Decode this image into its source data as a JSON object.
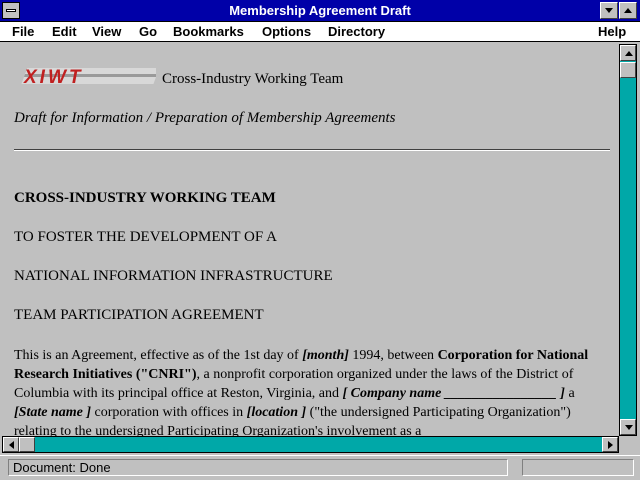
{
  "window": {
    "title": "Membership Agreement Draft"
  },
  "menu": {
    "file": "File",
    "edit": "Edit",
    "view": "View",
    "go": "Go",
    "bookmarks": "Bookmarks",
    "options": "Options",
    "directory": "Directory",
    "help": "Help"
  },
  "document": {
    "logo_text": "XIWT",
    "org_name": "Cross-Industry Working Team",
    "draft_note": "Draft for Information / Preparation of Membership Agreements",
    "heading_1": "CROSS-INDUSTRY WORKING TEAM",
    "heading_2": "TO FOSTER THE DEVELOPMENT OF A",
    "heading_3": "NATIONAL INFORMATION INFRASTRUCTURE",
    "heading_4": "TEAM PARTICIPATION AGREEMENT",
    "paragraph": {
      "p1": "This is an Agreement, effective as of the 1st day of ",
      "month": "[month]",
      "p2": " 1994, between ",
      "cnri": "Corporation for National Research Initiatives (\"CNRI\")",
      "p3": ", a nonprofit corporation organized under the laws of the District of Columbia with its principal office at Reston, Virginia, and ",
      "company": "[ Company name ________________ ]",
      "p4": " a ",
      "state": "[State name ]",
      "p5": " corporation with offices in ",
      "location": "[location ]",
      "p6": " (\"the undersigned Participating Organization\") relating to the undersigned Participating Organization's involvement as a"
    }
  },
  "status": {
    "text": "Document: Done"
  },
  "colors": {
    "title_bar": "#0000a8",
    "scrollbar_track": "#00a8a8",
    "face": "#c0c0c0",
    "logo_red": "#c02020"
  },
  "icons": {
    "system_menu": "system-menu-icon",
    "minimize": "minimize-icon",
    "maximize": "maximize-icon",
    "scroll_up": "arrow-up-icon",
    "scroll_down": "arrow-down-icon",
    "scroll_left": "arrow-left-icon",
    "scroll_right": "arrow-right-icon"
  }
}
